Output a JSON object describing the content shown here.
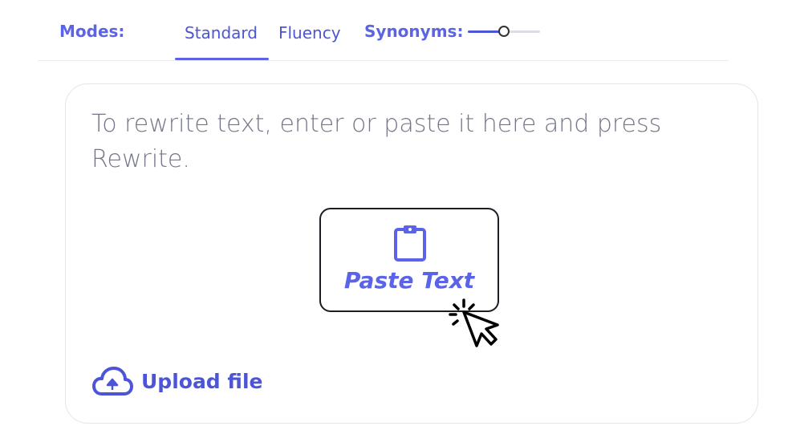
{
  "modes": {
    "label": "Modes:",
    "tabs": [
      {
        "label": "Standard",
        "active": true
      },
      {
        "label": "Fluency",
        "active": false
      }
    ]
  },
  "synonyms": {
    "label": "Synonyms:",
    "level": 0.5
  },
  "editor": {
    "placeholder": "To rewrite text, enter or paste it here and press Rewrite.",
    "paste_button": {
      "label": "Paste Text",
      "icon": "clipboard-icon"
    },
    "upload": {
      "label": "Upload file",
      "icon": "cloud-upload-icon"
    }
  },
  "colors": {
    "accent": "#5b63e6",
    "text_muted": "#74768a",
    "border": "#e4e4ea"
  }
}
